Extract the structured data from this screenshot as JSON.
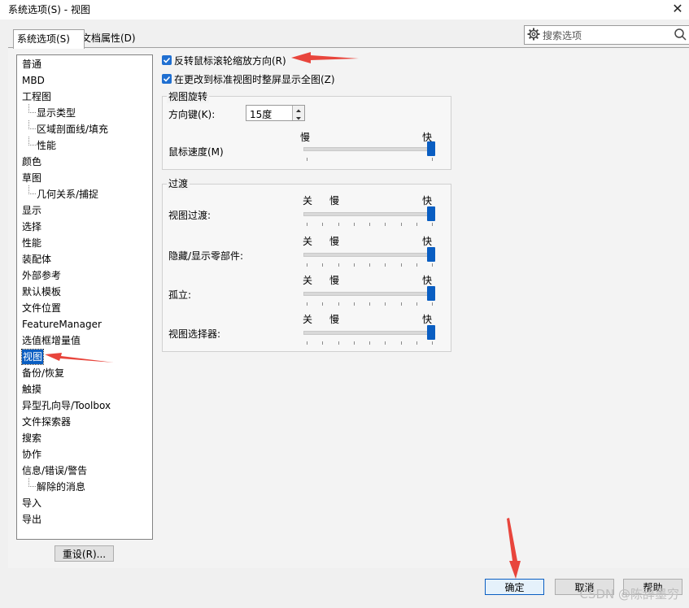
{
  "window": {
    "title": "系统选项(S) - 视图",
    "close_label": "✕"
  },
  "tabs": [
    {
      "label": "系统选项(S)",
      "active": true
    },
    {
      "label": "文档属性(D)",
      "active": false
    }
  ],
  "search": {
    "placeholder": "搜索选项"
  },
  "tree": {
    "items": [
      {
        "label": "普通",
        "level": 0
      },
      {
        "label": "MBD",
        "level": 0
      },
      {
        "label": "工程图",
        "level": 0
      },
      {
        "label": "显示类型",
        "level": 1
      },
      {
        "label": "区域剖面线/填充",
        "level": 1
      },
      {
        "label": "性能",
        "level": 1
      },
      {
        "label": "颜色",
        "level": 0
      },
      {
        "label": "草图",
        "level": 0
      },
      {
        "label": "几何关系/捕捉",
        "level": 1
      },
      {
        "label": "显示",
        "level": 0
      },
      {
        "label": "选择",
        "level": 0
      },
      {
        "label": "性能",
        "level": 0
      },
      {
        "label": "装配体",
        "level": 0
      },
      {
        "label": "外部参考",
        "level": 0
      },
      {
        "label": "默认模板",
        "level": 0
      },
      {
        "label": "文件位置",
        "level": 0
      },
      {
        "label": "FeatureManager",
        "level": 0
      },
      {
        "label": "选值框增量值",
        "level": 0
      },
      {
        "label": "视图",
        "level": 0,
        "selected": true
      },
      {
        "label": "备份/恢复",
        "level": 0
      },
      {
        "label": "触摸",
        "level": 0
      },
      {
        "label": "异型孔向导/Toolbox",
        "level": 0
      },
      {
        "label": "文件探索器",
        "level": 0
      },
      {
        "label": "搜索",
        "level": 0
      },
      {
        "label": "协作",
        "level": 0
      },
      {
        "label": "信息/错误/警告",
        "level": 0
      },
      {
        "label": "解除的消息",
        "level": 1
      },
      {
        "label": "导入",
        "level": 0
      },
      {
        "label": "导出",
        "level": 0
      }
    ]
  },
  "options": {
    "reverse_wheel_zoom": {
      "label": "反转鼠标滚轮缩放方向(R)",
      "checked": true
    },
    "zoom_to_fit": {
      "label": "在更改到标准视图时整屏显示全图(Z)",
      "checked": true
    }
  },
  "rotation": {
    "group_label": "视图旋转",
    "arrow_keys_label": "方向键(K):",
    "arrow_keys_value": "15度",
    "mouse_speed_label": "鼠标速度(M)",
    "slow": "慢",
    "fast": "快",
    "mouse_speed_level": 1.0
  },
  "transition": {
    "group_label": "过渡",
    "off": "关",
    "slow": "慢",
    "fast": "快",
    "rows": [
      {
        "label": "视图过渡:",
        "level": 1.0
      },
      {
        "label": "隐藏/显示零部件:",
        "level": 1.0
      },
      {
        "label": "孤立:",
        "level": 1.0
      },
      {
        "label": "视图选择器:",
        "level": 1.0
      }
    ]
  },
  "buttons": {
    "reset": "重设(R)...",
    "ok": "确定",
    "cancel": "取消",
    "help": "帮助"
  },
  "watermark": "CSDN @陈辞墨穷",
  "colors": {
    "accent": "#0a5ec2",
    "annotation_arrow": "#e8453c"
  }
}
